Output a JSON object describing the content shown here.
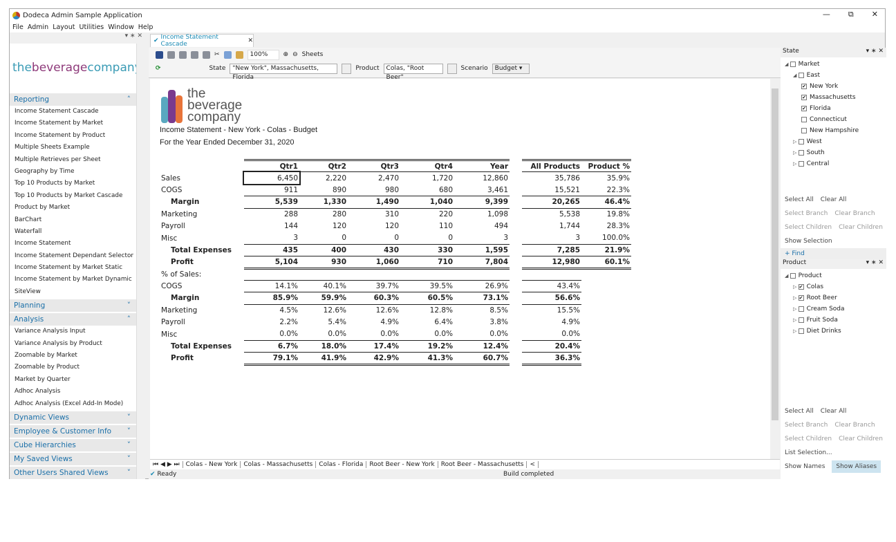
{
  "app": {
    "title": "Dodeca Admin Sample Application",
    "menu": [
      "File",
      "Admin",
      "Layout",
      "Utilities",
      "Window",
      "Help"
    ],
    "window_buttons": [
      "minimize-icon",
      "restore-icon",
      "close-icon"
    ]
  },
  "sidebar": {
    "brand": {
      "the": "the",
      "beverage": "beverage",
      "company": "company"
    },
    "sections": [
      {
        "label": "Reporting",
        "expanded": true,
        "items": [
          "Income Statement Cascade",
          "Income Statement by Market",
          "Income Statement by Product",
          "Multiple Sheets Example",
          "Multiple Retrieves per Sheet",
          "Geography by Time",
          "Top 10 Products by Market",
          "Top 10 Products by Market Cascade",
          "Product by Market",
          "BarChart",
          "Waterfall",
          "Income Statement",
          "Income Statement Dependant Selector",
          "Income Statement by Market Static",
          "Income Statement by Market Dynamic",
          "SiteView"
        ]
      },
      {
        "label": "Planning",
        "expanded": false,
        "items": []
      },
      {
        "label": "Analysis",
        "expanded": true,
        "items": [
          "Variance Analysis Input",
          "Variance Analysis by Product",
          "Zoomable by Market",
          "Zoomable by Product",
          "Market by Quarter",
          "Adhoc Analysis",
          "Adhoc Analysis (Excel Add-In Mode)"
        ]
      },
      {
        "label": "Dynamic Views",
        "expanded": false,
        "items": []
      },
      {
        "label": "Employee & Customer Info",
        "expanded": false,
        "items": []
      },
      {
        "label": "Cube Hierarchies",
        "expanded": false,
        "items": []
      },
      {
        "label": "My Saved Views",
        "expanded": false,
        "items": []
      },
      {
        "label": "Other Users Shared Views",
        "expanded": false,
        "items": []
      }
    ]
  },
  "document": {
    "tab": "Income Statement Cascade",
    "zoom": "100%",
    "sheets_label": "Sheets",
    "selectors": {
      "state_label": "State",
      "state_value": "\"New York\", Massachusetts, Florida",
      "product_label": "Product",
      "product_value": "Colas, \"Root Beer\"",
      "scenario_label": "Scenario",
      "scenario_value": "Budget"
    }
  },
  "report": {
    "logo": {
      "the": "the",
      "beverage": "beverage",
      "company": "company"
    },
    "title": "Income Statement - New York - Colas - Budget",
    "subtitle": "For the Year Ended December 31, 2020",
    "columns": [
      "Qtr1",
      "Qtr2",
      "Qtr3",
      "Qtr4",
      "Year",
      "All Products",
      "Product %"
    ],
    "rows": [
      {
        "label": "Sales",
        "values": [
          "6,450",
          "2,220",
          "2,470",
          "1,720",
          "12,860",
          "35,786",
          "35.9%"
        ]
      },
      {
        "label": "COGS",
        "values": [
          "911",
          "890",
          "980",
          "680",
          "3,461",
          "15,521",
          "22.3%"
        ]
      },
      {
        "label": "Margin",
        "values": [
          "5,539",
          "1,330",
          "1,490",
          "1,040",
          "9,399",
          "20,265",
          "46.4%"
        ]
      },
      {
        "label": "Marketing",
        "values": [
          "288",
          "280",
          "310",
          "220",
          "1,098",
          "5,538",
          "19.8%"
        ]
      },
      {
        "label": "Payroll",
        "values": [
          "144",
          "120",
          "120",
          "110",
          "494",
          "1,744",
          "28.3%"
        ]
      },
      {
        "label": "Misc",
        "values": [
          "3",
          "0",
          "0",
          "0",
          "3",
          "3",
          "100.0%"
        ]
      },
      {
        "label": "Total Expenses",
        "values": [
          "435",
          "400",
          "430",
          "330",
          "1,595",
          "7,285",
          "21.9%"
        ]
      },
      {
        "label": "Profit",
        "values": [
          "5,104",
          "930",
          "1,060",
          "710",
          "7,804",
          "12,980",
          "60.1%"
        ]
      }
    ],
    "pct_header": "% of Sales:",
    "pct_rows": [
      {
        "label": "COGS",
        "values": [
          "14.1%",
          "40.1%",
          "39.7%",
          "39.5%",
          "26.9%",
          "43.4%"
        ]
      },
      {
        "label": "Margin",
        "values": [
          "85.9%",
          "59.9%",
          "60.3%",
          "60.5%",
          "73.1%",
          "56.6%"
        ]
      },
      {
        "label": "Marketing",
        "values": [
          "4.5%",
          "12.6%",
          "12.6%",
          "12.8%",
          "8.5%",
          "15.5%"
        ]
      },
      {
        "label": "Payroll",
        "values": [
          "2.2%",
          "5.4%",
          "4.9%",
          "6.4%",
          "3.8%",
          "4.9%"
        ]
      },
      {
        "label": "Misc",
        "values": [
          "0.0%",
          "0.0%",
          "0.0%",
          "0.0%",
          "0.0%",
          "0.0%"
        ]
      },
      {
        "label": "Total Expenses",
        "values": [
          "6.7%",
          "18.0%",
          "17.4%",
          "19.2%",
          "12.4%",
          "20.4%"
        ]
      },
      {
        "label": "Profit",
        "values": [
          "79.1%",
          "41.9%",
          "42.9%",
          "41.3%",
          "60.7%",
          "36.3%"
        ]
      }
    ]
  },
  "sheet_tabs": [
    "Colas - New York",
    "Colas - Massachusetts",
    "Colas - Florida",
    "Root Beer - New York",
    "Root Beer - Massachusetts"
  ],
  "status": {
    "left": "Ready",
    "right": "Build completed"
  },
  "state_panel": {
    "title": "State",
    "tree": [
      {
        "label": "Market",
        "checked": false,
        "level": 0
      },
      {
        "label": "East",
        "checked": false,
        "level": 1
      },
      {
        "label": "New York",
        "checked": true,
        "level": 2
      },
      {
        "label": "Massachusetts",
        "checked": true,
        "level": 2
      },
      {
        "label": "Florida",
        "checked": true,
        "level": 2
      },
      {
        "label": "Connecticut",
        "checked": false,
        "level": 2
      },
      {
        "label": "New Hampshire",
        "checked": false,
        "level": 2
      },
      {
        "label": "West",
        "checked": false,
        "level": 1
      },
      {
        "label": "South",
        "checked": false,
        "level": 1
      },
      {
        "label": "Central",
        "checked": false,
        "level": 1
      }
    ],
    "select_all": "Select All",
    "clear_all": "Clear All",
    "select_branch": "Select Branch",
    "clear_branch": "Clear Branch",
    "select_children": "Select Children",
    "clear_children": "Clear Children",
    "show_selection": "Show Selection",
    "find": "Find"
  },
  "product_panel": {
    "title": "Product",
    "tree": [
      {
        "label": "Product",
        "checked": false,
        "level": 0
      },
      {
        "label": "Colas",
        "checked": true,
        "level": 1
      },
      {
        "label": "Root Beer",
        "checked": true,
        "level": 1
      },
      {
        "label": "Cream Soda",
        "checked": false,
        "level": 1
      },
      {
        "label": "Fruit Soda",
        "checked": false,
        "level": 1
      },
      {
        "label": "Diet Drinks",
        "checked": false,
        "level": 1
      }
    ],
    "select_all": "Select All",
    "clear_all": "Clear All",
    "select_branch": "Select Branch",
    "clear_branch": "Clear Branch",
    "select_children": "Select Children",
    "clear_children": "Clear Children",
    "list_selection": "List Selection...",
    "show_names": "Show Names",
    "show_aliases": "Show Aliases"
  },
  "colors": {
    "accent": "#1a6fa8",
    "brand_the": "#3a9bb5",
    "brand_beverage": "#8e3a7a",
    "brand_company": "#3a9bb5"
  }
}
